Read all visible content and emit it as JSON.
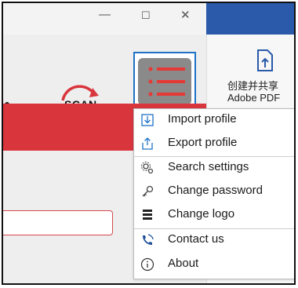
{
  "window": {
    "minimize_icon": "minimize-icon",
    "maximize_icon": "maximize-icon",
    "close_icon": "close-icon",
    "minimize_glyph": "—",
    "maximize_glyph": "☐",
    "close_glyph": "✕"
  },
  "toolbar": {
    "scan_label": "SCAN",
    "pdf_label": "创建并共享 Adobe PDF"
  },
  "menu": {
    "items": [
      {
        "label": "Import profile",
        "icon": "import-icon"
      },
      {
        "label": "Export profile",
        "icon": "export-icon"
      },
      {
        "label": "Search settings",
        "icon": "search-settings-icon"
      },
      {
        "label": "Change password",
        "icon": "key-icon"
      },
      {
        "label": "Change logo",
        "icon": "logo-stack-icon"
      },
      {
        "label": "Contact us",
        "icon": "phone-icon"
      },
      {
        "label": "About",
        "icon": "info-icon"
      }
    ]
  },
  "colors": {
    "accent_blue": "#1e73c6",
    "scan_red": "#d9353d",
    "menu_icon_red": "#e53935",
    "title_blue": "#2a5aa9"
  }
}
